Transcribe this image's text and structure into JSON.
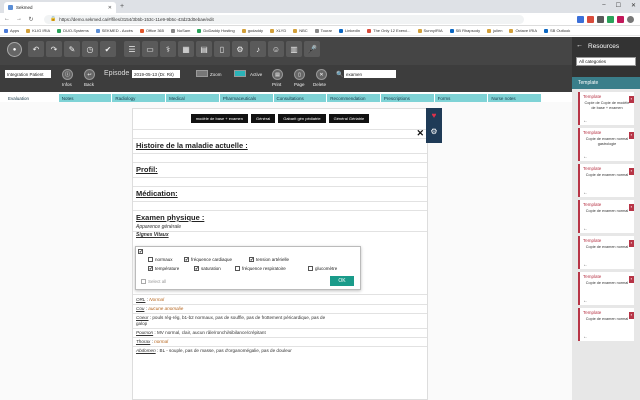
{
  "browser": {
    "tab_title": "Sekmed",
    "url": "https://demo.sekmed.ca/#/files/3154/3b5b-153c-11e9-9b5c-43d23d0ebae/edit",
    "bookmarks": [
      "Apps",
      "KLIG IRIA",
      "DUO-Systems",
      "SEKMED - Accès",
      "Office 365",
      "NoSam",
      "DoDaddy Hosting",
      "godaddy",
      "XLYD",
      "NBC",
      "Tourar",
      "LinkedIn",
      "The Only 12 Exerci...",
      "SunnyIRIA",
      "SB Rhapsody",
      "julien",
      "Octave IRIA",
      "SB Outlook"
    ]
  },
  "toolbar": {
    "patient_field": "Integration Patient",
    "infos_label": "Infos",
    "back_label": "Back",
    "episode_label": "Episode",
    "episode_value": "2019-05-13 (Dr. Rit)",
    "zoom_label": "Zoom",
    "active_label": "Active",
    "search_value": "examen",
    "print_label": "Print",
    "page_label": "Page",
    "delete_label": "Delete"
  },
  "section_tabs": [
    "Evaluation",
    "Notes",
    "Radiology",
    "Medical",
    "Pharmaceuticals",
    "Consultations",
    "Recommendation",
    "Prescriptions",
    "Forms",
    "Nurse notes"
  ],
  "document": {
    "template_buttons": [
      "modèle de base + examen",
      "Général",
      "Gabarit gén pédiatrie",
      "Général Gériatrie"
    ],
    "sections": [
      "Histoire de la maladie actuelle :",
      "Profil:",
      "Médication:",
      "Examen physique :"
    ],
    "apparence": "Apparence générale",
    "signes": "Signes Vitaux",
    "vitals_options": [
      "normaux",
      "fréquence cardiaque",
      "tension artérielle",
      "température",
      "saturation",
      "fréquence respiratoire",
      "glucomètre"
    ],
    "select_all": "Select all",
    "ok_label": "OK",
    "exam_lines": [
      {
        "label": "ORL",
        "text": "Normal"
      },
      {
        "label": "Cou",
        "text": "aucune anomalie"
      },
      {
        "label": "Coeur",
        "text": "pouls rég-rég, b1-b2 normaux, pas de souffle, pas de frottement péricardique, pas de"
      },
      {
        "label": "",
        "text": "galop"
      },
      {
        "label": "Poumon",
        "text": "MV normal, clair, aucun râle/ronchi/sibilance/crépitant"
      },
      {
        "label": "Thorax",
        "text": "normal"
      },
      {
        "label": "Abdomen",
        "text": "BL - souple, pas de masse, pas d'organomégalie, pas de douleur"
      }
    ]
  },
  "resources": {
    "title": "Resources",
    "filter_value": "All categories",
    "section": "Template",
    "cards": [
      {
        "head": "Template",
        "body": "Copie de Copie de modèle de base + examen"
      },
      {
        "head": "Template",
        "body": "Copie de examen normal gastrologie"
      },
      {
        "head": "Template",
        "body": "Copie de examen normal"
      },
      {
        "head": "Template",
        "body": "Copie de examen normal"
      },
      {
        "head": "Template",
        "body": "Copie de examen normal"
      },
      {
        "head": "Template",
        "body": "Copie de examen normal"
      },
      {
        "head": "Template",
        "body": "Copie de examen normal"
      }
    ]
  }
}
